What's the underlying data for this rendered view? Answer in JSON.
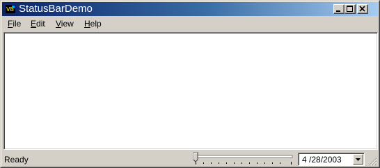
{
  "window": {
    "title": "StatusBarDemo"
  },
  "menu": {
    "items": [
      "File",
      "Edit",
      "View",
      "Help"
    ]
  },
  "statusbar": {
    "status_text": "Ready",
    "slider_value": 0,
    "date_value": "4 /28/2003"
  },
  "icons": {
    "app": "app-icon",
    "minimize": "minimize-icon",
    "maximize": "maximize-icon",
    "close": "close-icon",
    "dropdown": "chevron-down-icon",
    "grip": "resize-grip-icon"
  },
  "colors": {
    "titlebar_start": "#0a246a",
    "titlebar_end": "#a6caf0",
    "face": "#d4d0c8",
    "client": "#ffffff"
  }
}
